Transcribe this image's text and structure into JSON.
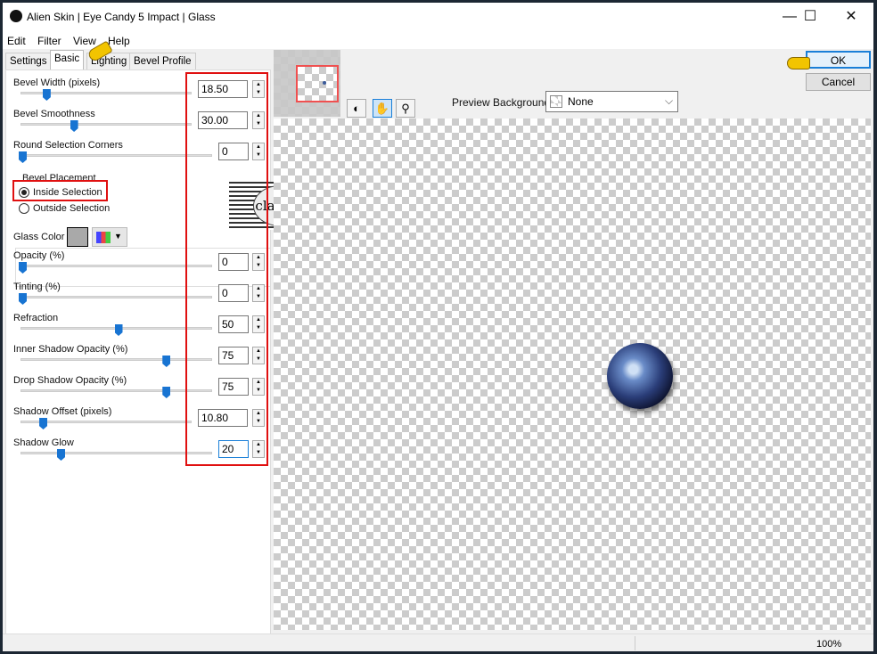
{
  "window": {
    "title": "Alien Skin | Eye Candy 5 Impact | Glass",
    "minimize": "—",
    "maximize": "☐",
    "close": "✕"
  },
  "menu": [
    "Edit",
    "Filter",
    "View",
    "Help"
  ],
  "tabs": [
    {
      "label": "Settings"
    },
    {
      "label": "Basic",
      "active": true
    },
    {
      "label": "Lighting"
    },
    {
      "label": "Bevel Profile"
    }
  ],
  "controls": [
    {
      "label": "Bevel Width (pixels)",
      "value": "18.50",
      "slider": 0.14
    },
    {
      "label": "Bevel Smoothness",
      "value": "30.00",
      "slider": 0.3
    },
    {
      "label": "Round Selection Corners",
      "value": "0",
      "slider": 0
    }
  ],
  "bevel_placement": {
    "label": "Bevel Placement",
    "options": [
      {
        "label": "Inside Selection",
        "selected": true
      },
      {
        "label": "Outside Selection",
        "selected": false
      }
    ]
  },
  "glass_color": {
    "label": "Glass Color",
    "color": "#a9a9a9"
  },
  "controls2": [
    {
      "label": "Opacity (%)",
      "value": "0",
      "slider": 0
    },
    {
      "label": "Tinting (%)",
      "value": "0",
      "slider": 0
    },
    {
      "label": "Refraction",
      "value": "50",
      "slider": 0.5
    },
    {
      "label": "Inner Shadow Opacity (%)",
      "value": "75",
      "slider": 0.75
    },
    {
      "label": "Drop Shadow Opacity (%)",
      "value": "75",
      "slider": 0.75
    },
    {
      "label": "Shadow Offset (pixels)",
      "value": "10.80",
      "slider": 0.12
    },
    {
      "label": "Shadow Glow",
      "value": "20",
      "slider": 0.2,
      "focused": true
    }
  ],
  "watermark": "claudia",
  "buttons": {
    "ok": "OK",
    "cancel": "Cancel"
  },
  "preview_background": {
    "label": "Preview Background:",
    "value": "None"
  },
  "status": {
    "zoom": "100%"
  },
  "colors": {
    "accent": "#1874d2",
    "highlight": "#e01010"
  }
}
